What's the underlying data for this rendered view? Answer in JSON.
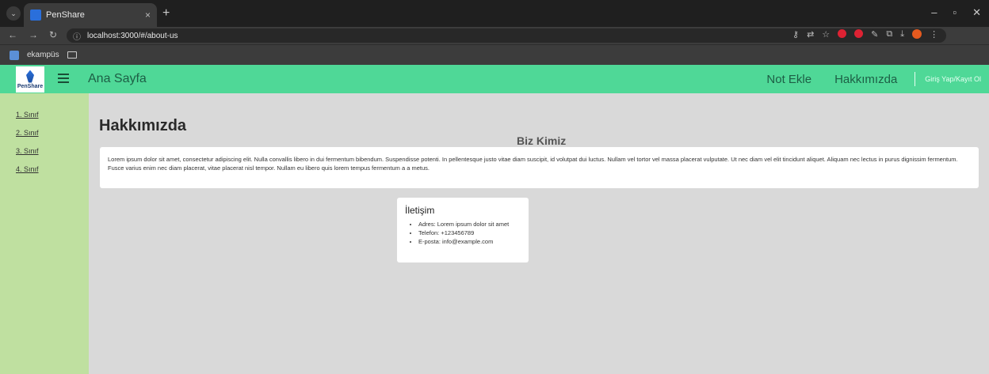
{
  "browser": {
    "tab_title": "PenShare",
    "tab_close": "×",
    "new_tab": "+",
    "url_info_icon": "ⓘ",
    "url": "localhost:3000/#/about-us",
    "bookmark_label": "ekampüs",
    "win_minimize": "–",
    "win_restore": "▫",
    "win_close": "✕"
  },
  "navbar": {
    "logo_text": "PenShare",
    "home_label": "Ana Sayfa",
    "add_note_label": "Not Ekle",
    "about_label": "Hakkımızda",
    "login_label": "Giriş Yap/Kayıt Ol",
    "color": "#4fd897"
  },
  "sidebar": {
    "items": [
      {
        "label": "1. Sınıf"
      },
      {
        "label": "2. Sınıf"
      },
      {
        "label": "3. Sınıf"
      },
      {
        "label": "4. Sınıf"
      }
    ],
    "color": "#bfe0a0"
  },
  "main": {
    "page_title": "Hakkımızda",
    "section_title": "Biz Kimiz",
    "lorem": "Lorem ipsum dolor sit amet, consectetur adipiscing elit. Nulla convallis libero in dui fermentum bibendum. Suspendisse potenti. In pellentesque justo vitae diam suscipit, id volutpat dui luctus. Nullam vel tortor vel massa placerat vulputate. Ut nec diam vel elit tincidunt aliquet. Aliquam nec lectus in purus dignissim fermentum. Fusce varius enim nec diam placerat, vitae placerat nisl tempor. Nullam eu libero quis lorem tempus fermentum a a metus.",
    "contact": {
      "title": "İletişim",
      "items": [
        {
          "text": "Adres: Lorem ipsum dolor sit amet"
        },
        {
          "text": "Telefon: +123456789"
        },
        {
          "text": "E-posta: info@example.com"
        }
      ]
    }
  }
}
